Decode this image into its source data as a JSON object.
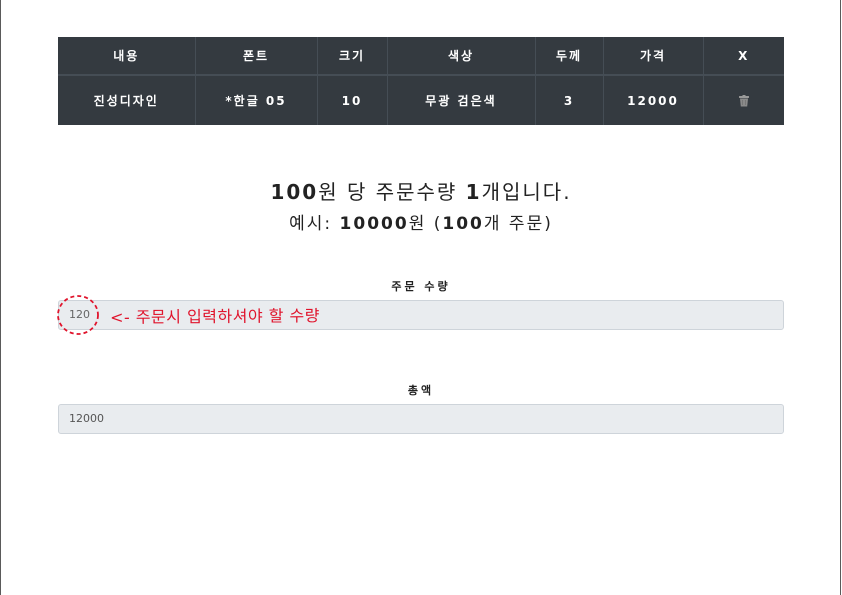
{
  "table": {
    "headers": [
      "내용",
      "폰트",
      "크기",
      "색상",
      "두께",
      "가격",
      "X"
    ],
    "row": {
      "content": "진성디자인",
      "font": "*한글 05",
      "size": "10",
      "color": "무광 검은색",
      "thickness": "3",
      "price": "12000"
    }
  },
  "info": {
    "line1_num": "100",
    "line1_mid": "원 당 주문수량 ",
    "line1_num2": "1",
    "line1_end": "개입니다.",
    "line2_pre": "예시: ",
    "line2_num": "10000",
    "line2_mid": "원 (",
    "line2_num2": "100",
    "line2_end": "개 주문)"
  },
  "form": {
    "qty_label": "주문 수량",
    "qty_value": "120",
    "total_label": "총액",
    "total_value": "12000"
  },
  "annotation": {
    "text": "<- 주문시 입력하셔야 할 수량",
    "color": "#e0142c"
  },
  "colors": {
    "table_bg": "#343a40",
    "field_bg": "#e9ecef"
  }
}
